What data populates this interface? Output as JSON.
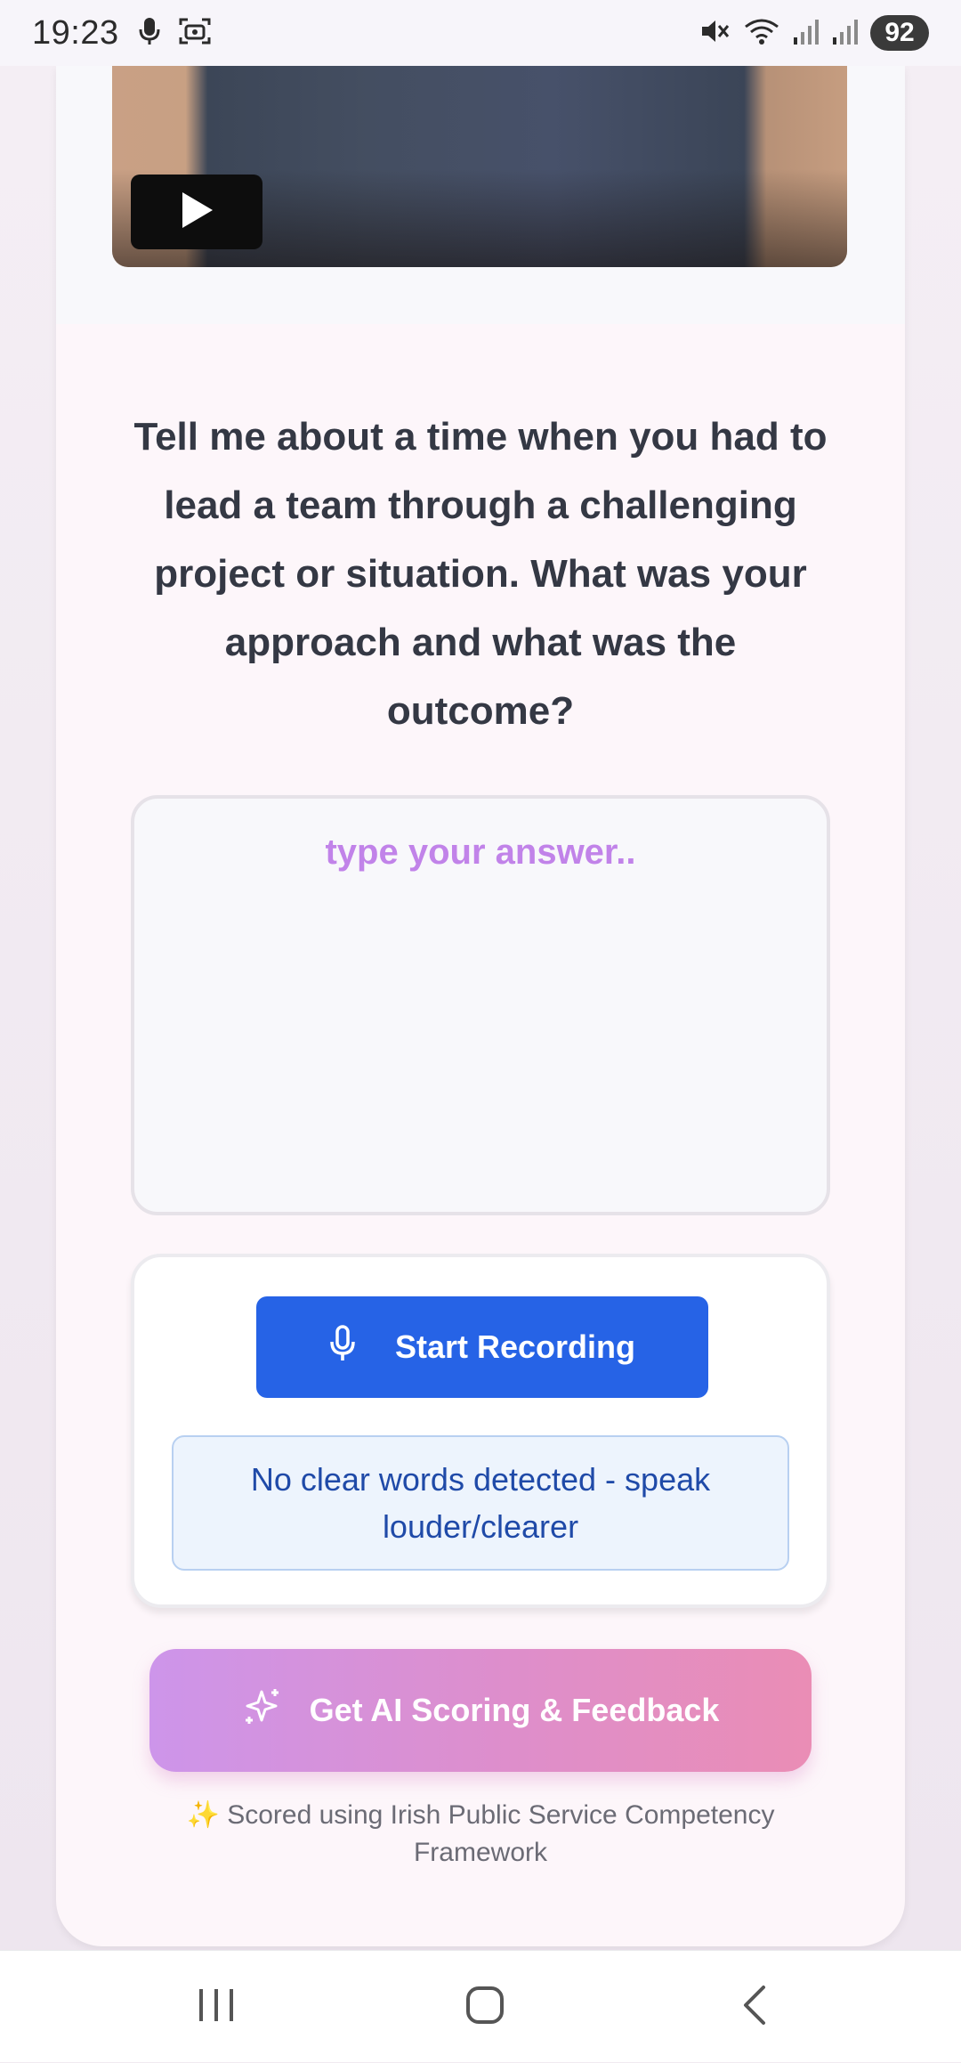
{
  "status_bar": {
    "time": "19:23",
    "battery": "92",
    "icons": [
      "mic-icon",
      "screen-record-icon",
      "mute-icon",
      "wifi-icon",
      "signal-icon",
      "signal-icon"
    ]
  },
  "video": {
    "play_icon": "play-icon"
  },
  "question": {
    "text": "Tell me about a time when you had to lead a team through a challenging project or situation. What was your approach and what was the outcome?"
  },
  "answer": {
    "placeholder": "type your answer..",
    "value": ""
  },
  "recording": {
    "button_label": "Start Recording",
    "button_icon": "microphone-icon",
    "status_message": "No clear words detected - speak louder/clearer"
  },
  "ai_feedback": {
    "button_label": "Get AI Scoring & Feedback",
    "button_icon": "sparkles-icon"
  },
  "footer": {
    "note": "✨ Scored using Irish Public Service Competency Framework"
  },
  "nav": {
    "recents": "recents-icon",
    "home": "home-icon",
    "back": "back-icon"
  },
  "colors": {
    "primary_blue": "#2663e6",
    "accent_purple": "#c183e9",
    "gradient_start": "#cd95ea",
    "gradient_end": "#ea8db5",
    "status_blue_text": "#1f4aa8"
  }
}
